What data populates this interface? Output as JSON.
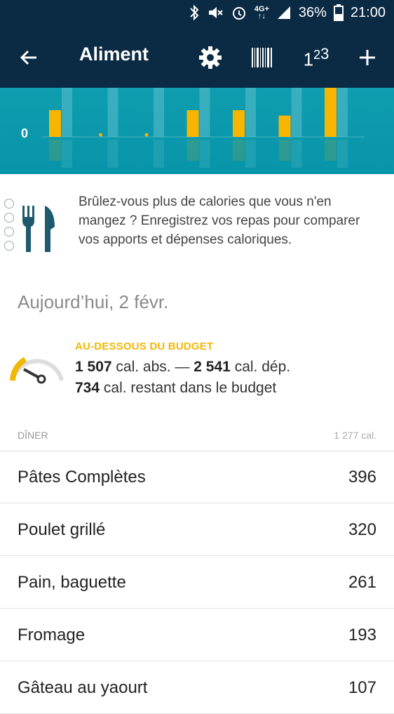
{
  "status_bar": {
    "network": "4G+",
    "battery": "36%",
    "time": "21:00",
    "icons": [
      "bluetooth-icon",
      "mute-icon",
      "alarm-icon",
      "network-4g-icon",
      "signal-icon",
      "battery-icon"
    ]
  },
  "toolbar": {
    "title": "Aliment",
    "number_button": "1",
    "number_button_sup": "2",
    "number_button_sup2": "3",
    "icons": [
      "back-arrow-icon",
      "gear-icon",
      "barcode-icon",
      "number-pad-icon",
      "plus-icon"
    ]
  },
  "chart_data": {
    "type": "bar",
    "series_count": 1,
    "axis_label": "0",
    "bars": [
      {
        "value": 1,
        "kind": "bar"
      },
      {
        "value": 0,
        "kind": "dot"
      },
      {
        "value": 0,
        "kind": "dot"
      },
      {
        "value": 1,
        "kind": "bar"
      },
      {
        "value": 1,
        "kind": "bar"
      },
      {
        "value": 0.8,
        "kind": "bar"
      },
      {
        "value": 2,
        "kind": "bar"
      }
    ],
    "colors": {
      "background": "#0a98ac",
      "bar": "#f7b500",
      "ghost": "#6cc6d2"
    }
  },
  "info": {
    "text": "Brûlez-vous plus de calories que vous n'en mangez ? Enregistrez vos repas pour comparer vos apports et dépenses caloriques."
  },
  "date": "Aujourd’hui, 2 févr.",
  "budget": {
    "status": "AU-DESSOUS DU BUDGET",
    "consumed": "1 507",
    "consumed_suffix": "cal. abs. —",
    "burned": "2 541",
    "burned_suffix": "cal. dép.",
    "remaining": "734",
    "remaining_suffix": "cal. restant dans le budget",
    "accent_color": "#f2b705"
  },
  "meal": {
    "name": "DÎNER",
    "total": "1 277 cal.",
    "items": [
      {
        "name": "Pâtes Complètes",
        "cal": "396"
      },
      {
        "name": "Poulet grillé",
        "cal": "320"
      },
      {
        "name": "Pain, baguette",
        "cal": "261"
      },
      {
        "name": "Fromage",
        "cal": "193"
      },
      {
        "name": "Gâteau au yaourt",
        "cal": "107"
      }
    ]
  }
}
